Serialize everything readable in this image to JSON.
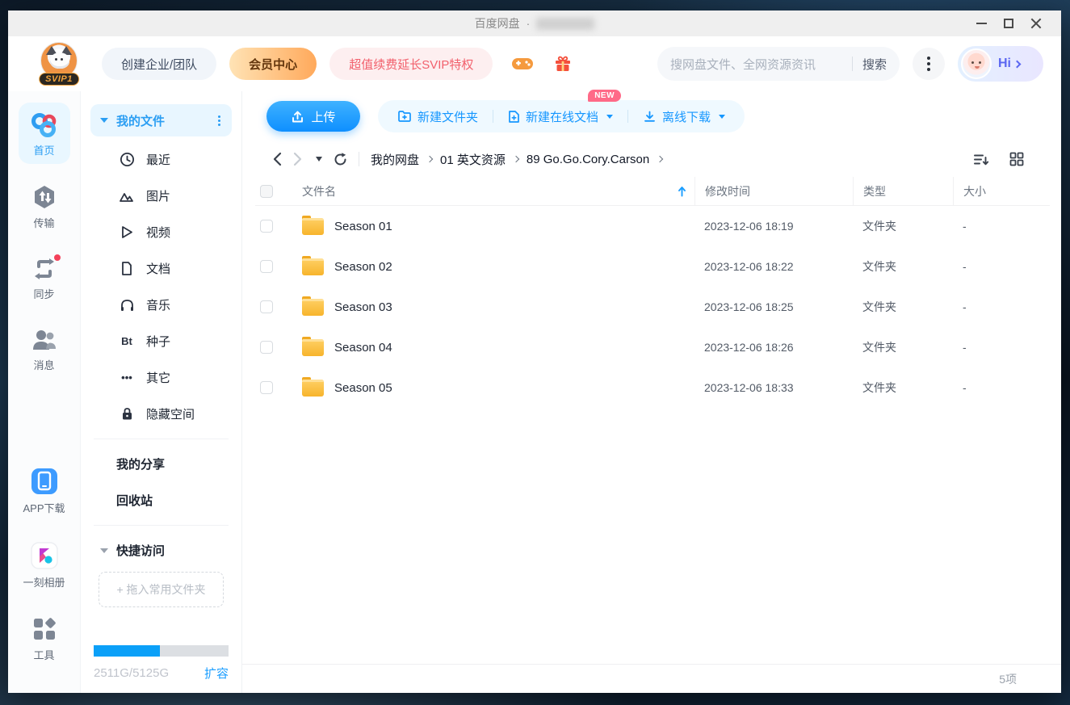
{
  "titlebar": {
    "app_title": "百度网盘",
    "separator": "·"
  },
  "header": {
    "logo_badge": "SVIP1",
    "create_team_label": "创建企业/团队",
    "member_center_label": "会员中心",
    "svip_promo_label": "超值续费延长SVIP特权",
    "search_placeholder": "搜网盘文件、全网资源资讯",
    "search_button_label": "搜索",
    "greeting": "Hi"
  },
  "rail": {
    "items": [
      {
        "label": "首页",
        "icon": "home-logo-icon",
        "active": true
      },
      {
        "label": "传输",
        "icon": "transfer-icon"
      },
      {
        "label": "同步",
        "icon": "sync-icon",
        "badge": "red-dot"
      },
      {
        "label": "消息",
        "icon": "messages-icon"
      }
    ],
    "bottom_items": [
      {
        "label": "APP下载",
        "icon": "app-download-icon"
      },
      {
        "label": "一刻相册",
        "icon": "photos-icon"
      },
      {
        "label": "工具",
        "icon": "tools-icon"
      }
    ]
  },
  "sidebar": {
    "my_files_label": "我的文件",
    "tree": [
      {
        "label": "最近",
        "icon": "clock-icon"
      },
      {
        "label": "图片",
        "icon": "image-icon"
      },
      {
        "label": "视频",
        "icon": "video-icon"
      },
      {
        "label": "文档",
        "icon": "document-icon"
      },
      {
        "label": "音乐",
        "icon": "music-icon"
      },
      {
        "label": "种子",
        "icon": "bt-icon",
        "icon_text": "Bt"
      },
      {
        "label": "其它",
        "icon": "more-dots-icon",
        "icon_text": "•••"
      },
      {
        "label": "隐藏空间",
        "icon": "lock-icon"
      }
    ],
    "links": [
      {
        "label": "我的分享"
      },
      {
        "label": "回收站"
      }
    ],
    "quick_access_label": "快捷访问",
    "drop_zone_hint": "+ 拖入常用文件夹",
    "storage": {
      "usage_text": "2511G/5125G",
      "expand_label": "扩容",
      "percent_used": 49
    }
  },
  "toolbar": {
    "upload_label": "上传",
    "new_folder_label": "新建文件夹",
    "new_online_doc_label": "新建在线文档",
    "new_badge": "NEW",
    "offline_download_label": "离线下载"
  },
  "breadcrumb": {
    "items": [
      "我的网盘",
      "01 英文资源",
      "89 Go.Go.Cory.Carson"
    ]
  },
  "table": {
    "headers": {
      "name": "文件名",
      "modified": "修改时间",
      "type": "类型",
      "size": "大小"
    },
    "sort_column": "name",
    "sort_direction": "asc",
    "rows": [
      {
        "name": "Season 01",
        "modified": "2023-12-06 18:19",
        "type": "文件夹",
        "size": "-"
      },
      {
        "name": "Season 02",
        "modified": "2023-12-06 18:22",
        "type": "文件夹",
        "size": "-"
      },
      {
        "name": "Season 03",
        "modified": "2023-12-06 18:25",
        "type": "文件夹",
        "size": "-"
      },
      {
        "name": "Season 04",
        "modified": "2023-12-06 18:26",
        "type": "文件夹",
        "size": "-"
      },
      {
        "name": "Season 05",
        "modified": "2023-12-06 18:33",
        "type": "文件夹",
        "size": "-"
      }
    ]
  },
  "footer": {
    "item_count": "5项"
  },
  "colors": {
    "primary_blue": "#0e8fff",
    "accent_blue": "#2b9ef3",
    "vip_orange": "#ffa95b",
    "svip_red": "#f2616d",
    "new_badge_pink": "#ff6a88",
    "folder_yellow": "#f7b42c"
  }
}
